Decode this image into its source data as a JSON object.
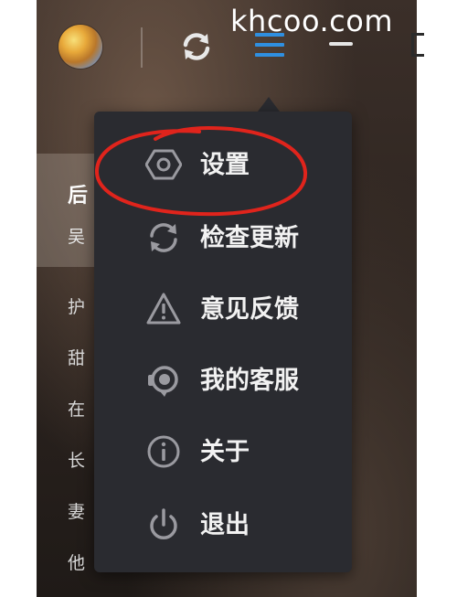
{
  "watermark": "khcoo.com",
  "song": {
    "title": "后",
    "artist": "吴"
  },
  "playlist": [
    "护",
    "甜",
    "在",
    "长",
    "妻",
    "他"
  ],
  "menu": {
    "items": [
      {
        "label": "设置",
        "icon": "settings-hexagon-icon"
      },
      {
        "label": "检查更新",
        "icon": "refresh-icon"
      },
      {
        "label": "意见反馈",
        "icon": "warning-triangle-icon"
      },
      {
        "label": "我的客服",
        "icon": "headset-icon"
      },
      {
        "label": "关于",
        "icon": "info-icon"
      },
      {
        "label": "退出",
        "icon": "power-icon"
      }
    ]
  },
  "colors": {
    "menu_bg": "#2a2b30",
    "accent_blue": "#2f8fe0",
    "annotation_red": "#e0241c"
  }
}
